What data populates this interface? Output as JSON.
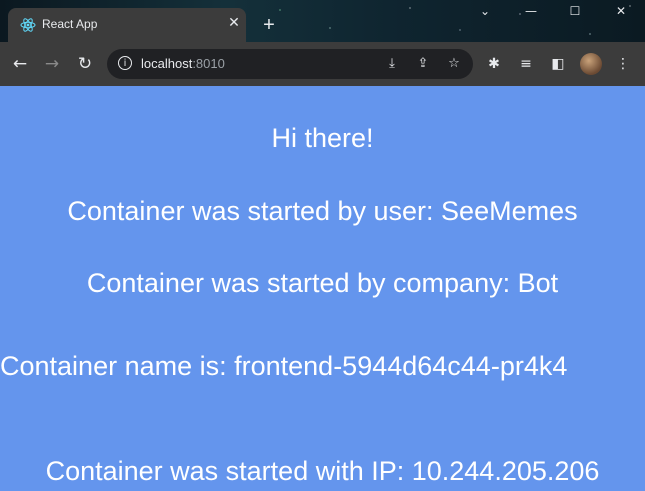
{
  "tab": {
    "title": "React App",
    "close_glyph": "✕"
  },
  "newtab_glyph": "+",
  "window": {
    "minimize_glyph": "—",
    "restore_glyph": "☐",
    "close_glyph": "✕",
    "menu_glyph": "⌄"
  },
  "nav": {
    "back_glyph": "←",
    "forward_glyph": "→",
    "reload_glyph": "↻"
  },
  "address": {
    "host": "localhost",
    "port": ":8010"
  },
  "icons": {
    "install": "⤓",
    "share": "⇪",
    "bookmark": "☆",
    "extensions": "✱",
    "reading_list": "≡",
    "side_panel": "◧",
    "menu": "⋮"
  },
  "page": {
    "greeting": "Hi there!",
    "user_line": "Container was started by user: SeeMemes",
    "company_line": "Container was started by company: Bot",
    "name_line": "Container name is: frontend-5944d64c44-pr4k4",
    "ip_line": "Container was started with IP: 10.244.205.206"
  }
}
